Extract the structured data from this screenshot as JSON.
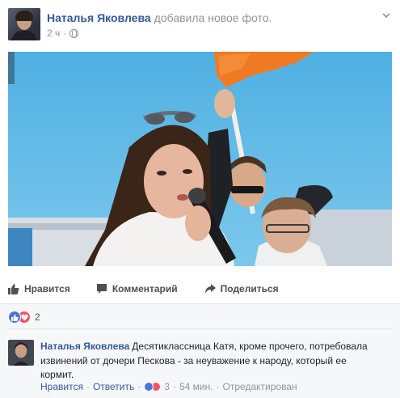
{
  "post": {
    "author": "Наталья Яковлева",
    "action": "добавила новое фото.",
    "time": "2 ч",
    "privacy_icon": "globe-icon"
  },
  "photo": {
    "icon": "photo-image"
  },
  "actions": {
    "like_label": "Нравится",
    "comment_label": "Комментарий",
    "share_label": "Поделиться"
  },
  "reactions": {
    "count": "2",
    "icons": [
      "like-reaction-icon",
      "love-reaction-icon"
    ]
  },
  "comment": {
    "author": "Наталья Яковлева",
    "text": "Десятиклассница Катя, кроме прочего, потребовала извинений от дочери Пескова - за неуважение к народу, который ее кормит.",
    "like_label": "Нравится",
    "reply_label": "Ответить",
    "reaction_count": "3",
    "time": "54 мин.",
    "edited_label": "Отредактирован"
  },
  "colors": {
    "link": "#365899",
    "muted": "#90949c",
    "sky": "#57b7e4",
    "flag": "#f07a24",
    "like_blue": "#4c75d8",
    "love_red": "#f25268"
  }
}
